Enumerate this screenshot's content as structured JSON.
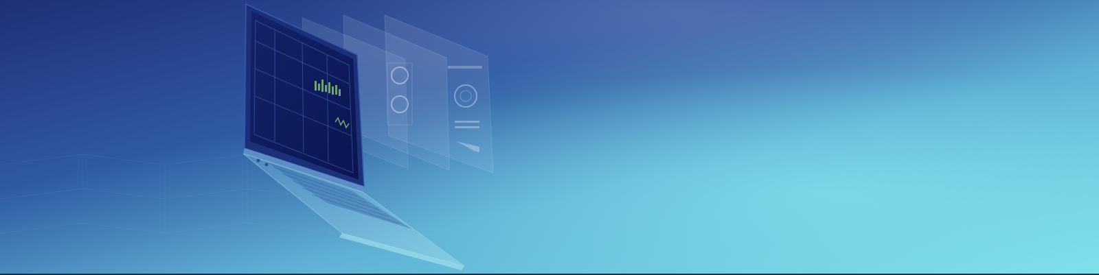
{
  "banner": {
    "description_icon": "laptop-with-floating-dashboard-panels",
    "colors": {
      "gradient_dark": "#1f2f78",
      "gradient_mid": "#3f8fc4",
      "gradient_light": "#7ee0ea",
      "screen_dark": "#0c1a5a",
      "screen_frame": "#223a88",
      "laptop_body": "#6aa9d4",
      "bottom_rule": "#1a2d3d"
    }
  }
}
